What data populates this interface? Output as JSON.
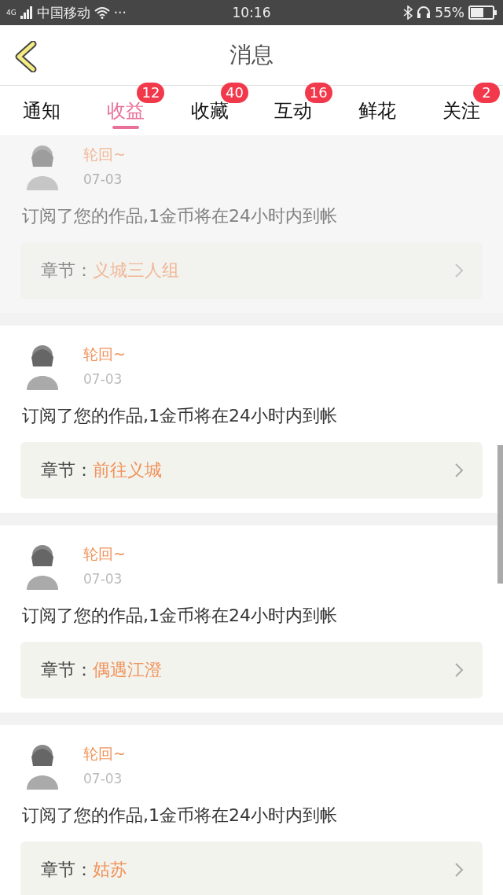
{
  "status_bar": {
    "network": "4G",
    "carrier": "中国移动",
    "dots": "···",
    "time": "10:16",
    "battery": "55%"
  },
  "header": {
    "title": "消息"
  },
  "tabs": [
    {
      "label": "通知",
      "selected": false
    },
    {
      "label": "收益",
      "badge": "12",
      "selected": true
    },
    {
      "label": "收藏",
      "badge": "40",
      "selected": false
    },
    {
      "label": "互动",
      "badge": "16",
      "selected": false
    },
    {
      "label": "鲜花",
      "selected": false
    },
    {
      "label": "关注",
      "badge": "2",
      "selected": false
    }
  ],
  "messages": [
    {
      "name": "轮回~",
      "date": "07-03",
      "text": "订阅了您的作品,1金币将在24小时内到帐",
      "chapter_label": "章节：",
      "chapter": "义城三人组",
      "faded": true
    },
    {
      "name": "轮回~",
      "date": "07-03",
      "text": "订阅了您的作品,1金币将在24小时内到帐",
      "chapter_label": "章节：",
      "chapter": "前往义城",
      "faded": false
    },
    {
      "name": "轮回~",
      "date": "07-03",
      "text": "订阅了您的作品,1金币将在24小时内到帐",
      "chapter_label": "章节：",
      "chapter": "偶遇江澄",
      "faded": false
    },
    {
      "name": "轮回~",
      "date": "07-03",
      "text": "订阅了您的作品,1金币将在24小时内到帐",
      "chapter_label": "章节：",
      "chapter": "姑苏",
      "faded": false
    }
  ]
}
